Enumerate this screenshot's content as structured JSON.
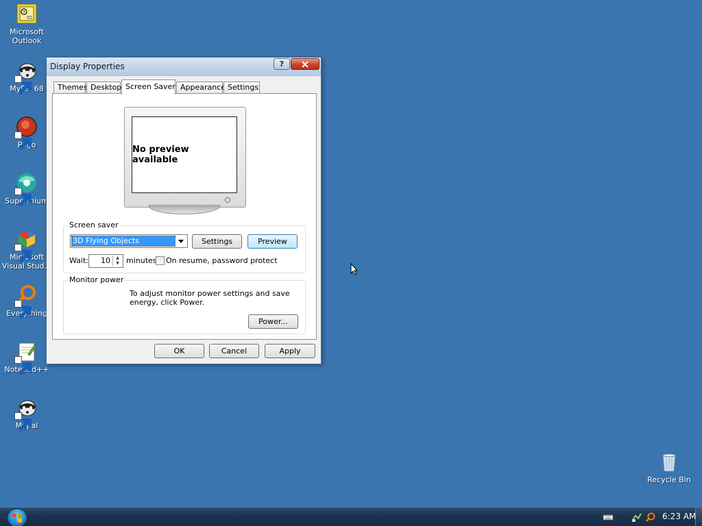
{
  "desktop": {
    "icons": [
      {
        "label": "Microsoft Outlook",
        "icon": "outlook-icon"
      },
      {
        "label": "MyPal 68",
        "icon": "mypal-icon"
      },
      {
        "label": "Pego",
        "icon": "pego-icon"
      },
      {
        "label": "Supermium",
        "icon": "supermium-icon"
      },
      {
        "label": "Microsoft Visual Stud...",
        "icon": "visual-studio-icon"
      },
      {
        "label": "Everything",
        "icon": "everything-icon"
      },
      {
        "label": "Notepad++",
        "icon": "notepadpp-icon"
      },
      {
        "label": "Mypal",
        "icon": "mypal-icon"
      },
      {
        "label": "Recycle Bin",
        "icon": "recycle-bin-icon"
      }
    ]
  },
  "dialog": {
    "title": "Display Properties",
    "help_label": "?",
    "tabs": [
      "Themes",
      "Desktop",
      "Screen Saver",
      "Appearance",
      "Settings"
    ],
    "active_tab": "Screen Saver",
    "preview_text": "No preview available",
    "screen_saver": {
      "group_label": "Screen saver",
      "selected": "3D Flying Objects",
      "settings_label": "Settings",
      "preview_label": "Preview",
      "wait_label": "Wait:",
      "wait_value": "10",
      "minutes_label": "minutes",
      "password_label": "On resume, password protect",
      "password_checked": false
    },
    "monitor_power": {
      "group_label": "Monitor power",
      "text": "To adjust monitor power settings and save energy, click Power.",
      "power_label": "Power..."
    },
    "buttons": {
      "ok": "OK",
      "cancel": "Cancel",
      "apply": "Apply"
    }
  },
  "taskbar": {
    "clock": "6:23 AM"
  },
  "colors": {
    "desktop_bg": "#3a75b0",
    "selection": "#3399ff"
  }
}
